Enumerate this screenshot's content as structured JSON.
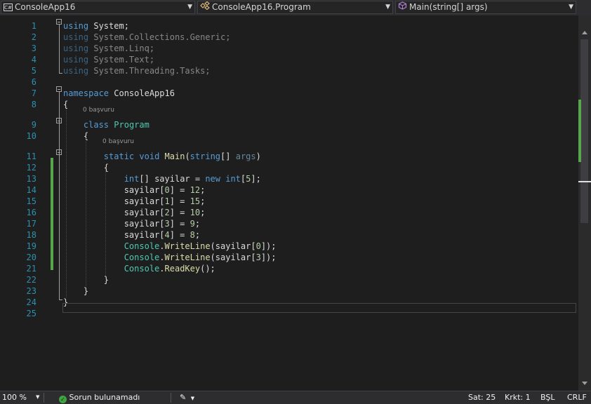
{
  "nav": {
    "project": "ConsoleApp16",
    "project_icon": "C#",
    "class": "ConsoleApp16.Program",
    "member": "Main(string[] args)"
  },
  "code_lens": {
    "class_refs": "0 başvuru",
    "method_refs": "0 başvuru"
  },
  "lines": [
    {
      "n": "1",
      "tokens": [
        {
          "t": "using",
          "c": "kw"
        },
        {
          "t": " System;",
          "c": ""
        }
      ]
    },
    {
      "n": "2",
      "tokens": [
        {
          "t": "using",
          "c": "kw"
        },
        {
          "t": " System.Collections.Generic;",
          "c": ""
        }
      ],
      "dim": true
    },
    {
      "n": "3",
      "tokens": [
        {
          "t": "using",
          "c": "kw"
        },
        {
          "t": " System.Linq;",
          "c": ""
        }
      ],
      "dim": true
    },
    {
      "n": "4",
      "tokens": [
        {
          "t": "using",
          "c": "kw"
        },
        {
          "t": " System.Text;",
          "c": ""
        }
      ],
      "dim": true
    },
    {
      "n": "5",
      "tokens": [
        {
          "t": "using",
          "c": "kw"
        },
        {
          "t": " System.Threading.Tasks;",
          "c": ""
        }
      ],
      "dim": true
    },
    {
      "n": "6",
      "tokens": []
    },
    {
      "n": "7",
      "tokens": [
        {
          "t": "namespace",
          "c": "kw"
        },
        {
          "t": " ConsoleApp16",
          "c": ""
        }
      ]
    },
    {
      "n": "8",
      "tokens": [
        {
          "t": "{",
          "c": ""
        }
      ]
    },
    {
      "n": "9",
      "tokens": [
        {
          "t": "    ",
          "c": ""
        },
        {
          "t": "class",
          "c": "kw"
        },
        {
          "t": " ",
          "c": ""
        },
        {
          "t": "Program",
          "c": "ty"
        }
      ]
    },
    {
      "n": "10",
      "tokens": [
        {
          "t": "    {",
          "c": ""
        }
      ]
    },
    {
      "n": "11",
      "tokens": [
        {
          "t": "        ",
          "c": ""
        },
        {
          "t": "static",
          "c": "kw"
        },
        {
          "t": " ",
          "c": ""
        },
        {
          "t": "void",
          "c": "kw"
        },
        {
          "t": " ",
          "c": ""
        },
        {
          "t": "Main",
          "c": "fn"
        },
        {
          "t": "(",
          "c": ""
        },
        {
          "t": "string",
          "c": "kw"
        },
        {
          "t": "[] ",
          "c": ""
        },
        {
          "t": "args",
          "c": "par dim"
        },
        {
          "t": ")",
          "c": ""
        }
      ]
    },
    {
      "n": "12",
      "tokens": [
        {
          "t": "        {",
          "c": ""
        }
      ]
    },
    {
      "n": "13",
      "tokens": [
        {
          "t": "            ",
          "c": ""
        },
        {
          "t": "int",
          "c": "kw"
        },
        {
          "t": "[] sayilar = ",
          "c": ""
        },
        {
          "t": "new",
          "c": "kw"
        },
        {
          "t": " ",
          "c": ""
        },
        {
          "t": "int",
          "c": "kw"
        },
        {
          "t": "[",
          "c": ""
        },
        {
          "t": "5",
          "c": "num"
        },
        {
          "t": "];",
          "c": ""
        }
      ]
    },
    {
      "n": "14",
      "tokens": [
        {
          "t": "            sayilar[",
          "c": ""
        },
        {
          "t": "0",
          "c": "num"
        },
        {
          "t": "] = ",
          "c": ""
        },
        {
          "t": "12",
          "c": "num"
        },
        {
          "t": ";",
          "c": ""
        }
      ]
    },
    {
      "n": "15",
      "tokens": [
        {
          "t": "            sayilar[",
          "c": ""
        },
        {
          "t": "1",
          "c": "num"
        },
        {
          "t": "] = ",
          "c": ""
        },
        {
          "t": "15",
          "c": "num"
        },
        {
          "t": ";",
          "c": ""
        }
      ]
    },
    {
      "n": "16",
      "tokens": [
        {
          "t": "            sayilar[",
          "c": ""
        },
        {
          "t": "2",
          "c": "num"
        },
        {
          "t": "] = ",
          "c": ""
        },
        {
          "t": "10",
          "c": "num"
        },
        {
          "t": ";",
          "c": ""
        }
      ]
    },
    {
      "n": "17",
      "tokens": [
        {
          "t": "            sayilar[",
          "c": ""
        },
        {
          "t": "3",
          "c": "num"
        },
        {
          "t": "] = ",
          "c": ""
        },
        {
          "t": "9",
          "c": "num"
        },
        {
          "t": ";",
          "c": ""
        }
      ]
    },
    {
      "n": "18",
      "tokens": [
        {
          "t": "            sayilar[",
          "c": ""
        },
        {
          "t": "4",
          "c": "num"
        },
        {
          "t": "] = ",
          "c": ""
        },
        {
          "t": "8",
          "c": "num"
        },
        {
          "t": ";",
          "c": ""
        }
      ]
    },
    {
      "n": "19",
      "tokens": [
        {
          "t": "            ",
          "c": ""
        },
        {
          "t": "Console",
          "c": "ty"
        },
        {
          "t": ".",
          "c": ""
        },
        {
          "t": "WriteLine",
          "c": "fn"
        },
        {
          "t": "(sayilar[",
          "c": ""
        },
        {
          "t": "0",
          "c": "num"
        },
        {
          "t": "]);",
          "c": ""
        }
      ]
    },
    {
      "n": "20",
      "tokens": [
        {
          "t": "            ",
          "c": ""
        },
        {
          "t": "Console",
          "c": "ty"
        },
        {
          "t": ".",
          "c": ""
        },
        {
          "t": "WriteLine",
          "c": "fn"
        },
        {
          "t": "(sayilar[",
          "c": ""
        },
        {
          "t": "3",
          "c": "num"
        },
        {
          "t": "]);",
          "c": ""
        }
      ]
    },
    {
      "n": "21",
      "tokens": [
        {
          "t": "            ",
          "c": ""
        },
        {
          "t": "Console",
          "c": "ty"
        },
        {
          "t": ".",
          "c": ""
        },
        {
          "t": "ReadKey",
          "c": "fn"
        },
        {
          "t": "();",
          "c": ""
        }
      ]
    },
    {
      "n": "22",
      "tokens": [
        {
          "t": "        }",
          "c": ""
        }
      ]
    },
    {
      "n": "23",
      "tokens": [
        {
          "t": "    }",
          "c": ""
        }
      ]
    },
    {
      "n": "24",
      "tokens": [
        {
          "t": "}",
          "c": ""
        }
      ]
    },
    {
      "n": "25",
      "tokens": []
    }
  ],
  "status": {
    "zoom": "100 %",
    "issues": "Sorun bulunamadı",
    "line": "Sat: 25",
    "col": "Krkt: 1",
    "mode": "BŞL",
    "eol": "CRLF"
  },
  "colors": {
    "keyword": "#569cd6",
    "type": "#4ec9b0",
    "method": "#dcdcaa",
    "number": "#b5cea8",
    "line_number": "#2b91af",
    "change_bar": "#57a64a",
    "ok_check": "#3fa33f"
  }
}
